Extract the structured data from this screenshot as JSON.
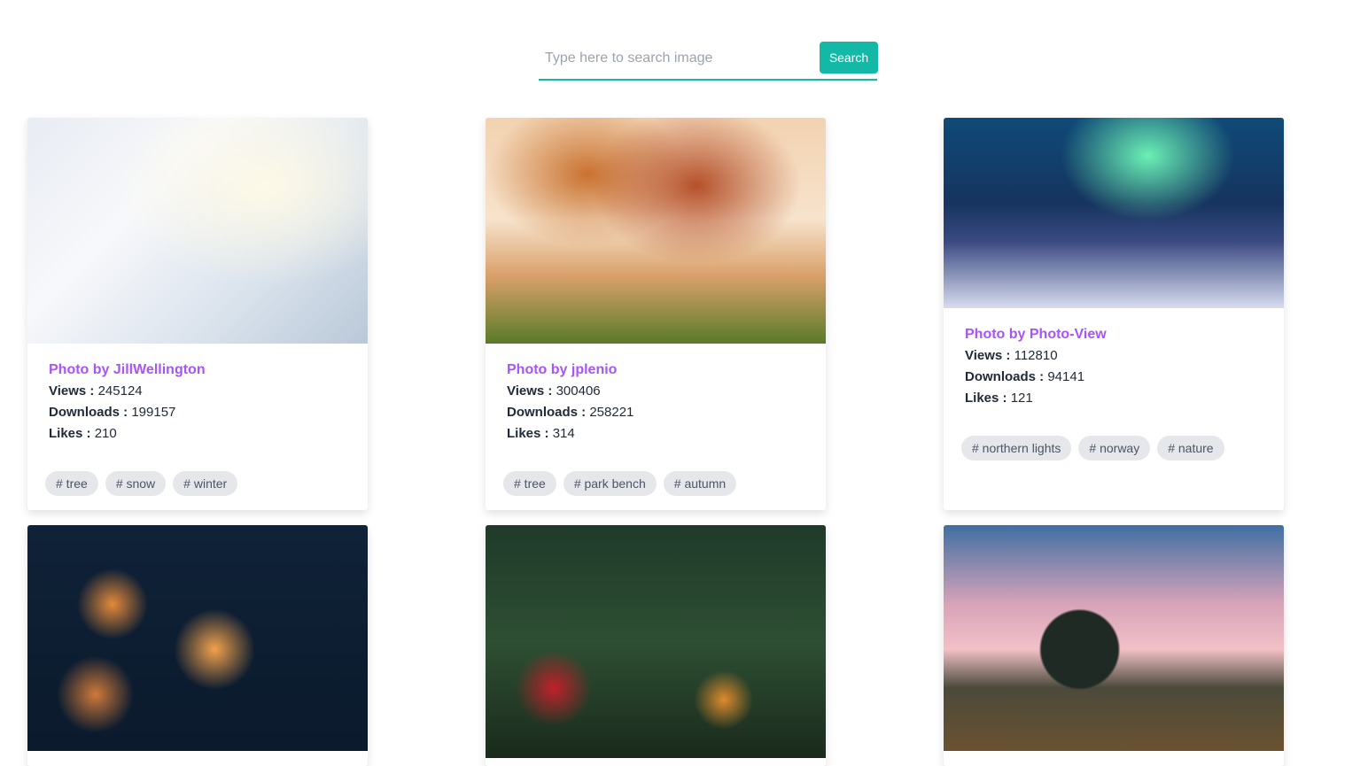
{
  "search": {
    "placeholder": "Type here to search image",
    "button_label": "Search",
    "accent_color": "#14b8a6"
  },
  "labels": {
    "views": "Views :",
    "downloads": "Downloads :",
    "likes": "Likes :"
  },
  "cards": [
    {
      "author": "Photo by JillWellington",
      "views": "245124",
      "downloads": "199157",
      "likes": "210",
      "tags": [
        "# tree",
        "# snow",
        "# winter"
      ]
    },
    {
      "author": "Photo by jplenio",
      "views": "300406",
      "downloads": "258221",
      "likes": "314",
      "tags": [
        "# tree",
        "# park bench",
        "# autumn"
      ]
    },
    {
      "author": "Photo by Photo-View",
      "views": "112810",
      "downloads": "94141",
      "likes": "121",
      "tags": [
        "# northern lights",
        "# norway",
        "# nature"
      ]
    },
    {},
    {},
    {}
  ],
  "colors": {
    "author": "#a855f7",
    "tag_bg": "#e5e7eb"
  }
}
